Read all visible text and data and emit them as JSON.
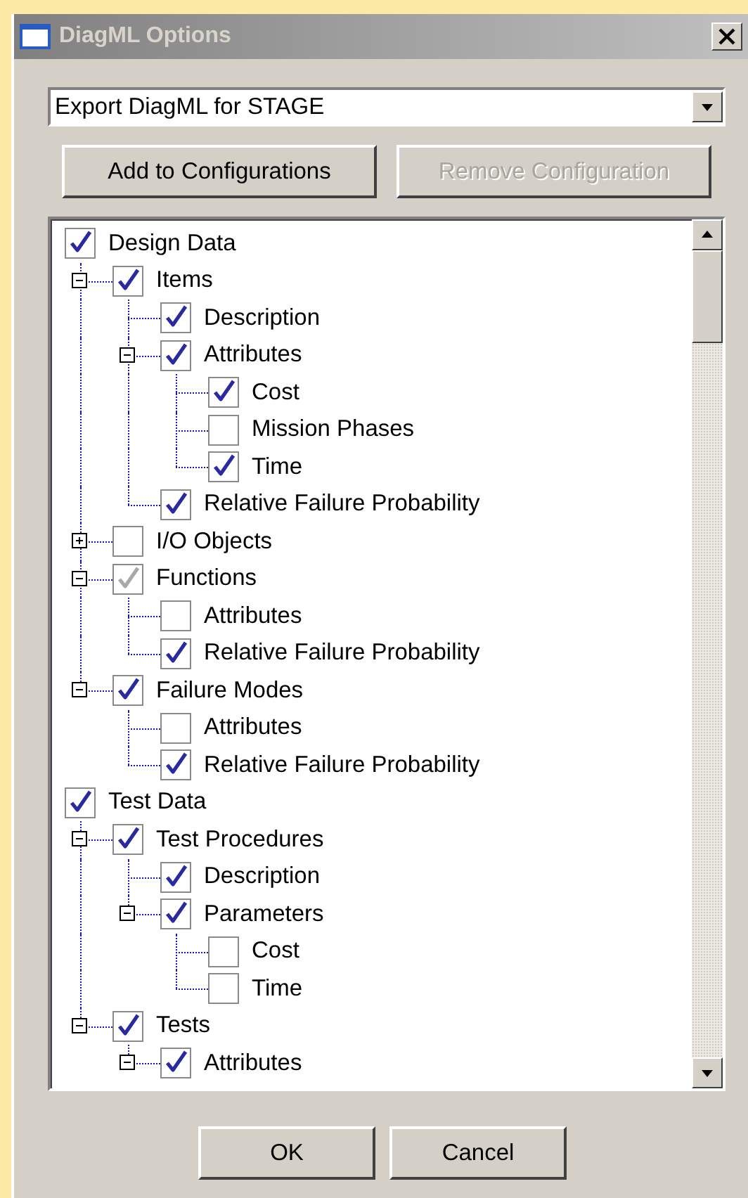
{
  "window": {
    "title": "DiagML Options"
  },
  "configuration": {
    "value": "Export DiagML for STAGE"
  },
  "config_buttons": [
    {
      "label": "Add to Configurations",
      "disabled": false
    },
    {
      "label": "Remove Configuration",
      "disabled": true
    }
  ],
  "tree": {
    "items": [
      {
        "label": "Design Data",
        "checked": true,
        "children": [
          {
            "label": "Items",
            "checked": true,
            "expanded": true,
            "children": [
              {
                "label": "Description",
                "checked": true
              },
              {
                "label": "Attributes",
                "checked": true,
                "expanded": true,
                "children": [
                  {
                    "label": "Cost",
                    "checked": true
                  },
                  {
                    "label": "Mission Phases",
                    "checked": false
                  },
                  {
                    "label": "Time",
                    "checked": true
                  }
                ]
              },
              {
                "label": "Relative Failure Probability",
                "checked": true
              }
            ]
          },
          {
            "label": "I/O Objects",
            "checked": false,
            "expanded": false
          },
          {
            "label": "Functions",
            "checked": true,
            "grayed": true,
            "expanded": true,
            "children": [
              {
                "label": "Attributes",
                "checked": false
              },
              {
                "label": "Relative Failure Probability",
                "checked": true
              }
            ]
          },
          {
            "label": "Failure Modes",
            "checked": true,
            "expanded": true,
            "children": [
              {
                "label": "Attributes",
                "checked": false
              },
              {
                "label": "Relative Failure Probability",
                "checked": true
              }
            ]
          }
        ]
      },
      {
        "label": "Test Data",
        "checked": true,
        "children": [
          {
            "label": "Test Procedures",
            "checked": true,
            "expanded": true,
            "children": [
              {
                "label": "Description",
                "checked": true
              },
              {
                "label": "Parameters",
                "checked": true,
                "expanded": true,
                "children": [
                  {
                    "label": "Cost",
                    "checked": false
                  },
                  {
                    "label": "Time",
                    "checked": false
                  }
                ]
              }
            ]
          },
          {
            "label": "Tests",
            "checked": true,
            "expanded": true,
            "children": [
              {
                "label": "Attributes",
                "checked": true,
                "expanded": true
              }
            ]
          }
        ]
      }
    ]
  },
  "dialog_buttons": [
    {
      "label": "OK"
    },
    {
      "label": "Cancel"
    }
  ]
}
